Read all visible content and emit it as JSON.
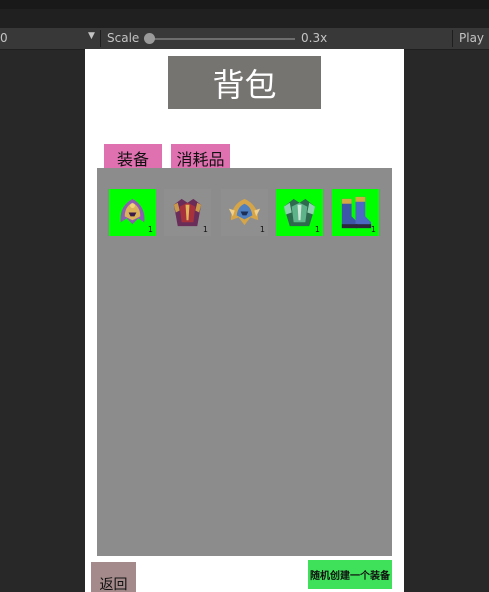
{
  "toolbar": {
    "resolution": "0",
    "scale_label": "Scale",
    "scale_value": "0.3x",
    "scale_level": 0.0,
    "play_label": "Play I"
  },
  "panel": {
    "title": "背包",
    "tabs": [
      {
        "label": "装备"
      },
      {
        "label": "消耗品"
      }
    ],
    "items": [
      {
        "icon": "helmet-purple-icon",
        "count": "1",
        "background": "#00ff00"
      },
      {
        "icon": "chest-armor-red-icon",
        "count": "1",
        "background": "#8f8f8f"
      },
      {
        "icon": "helmet-blue-icon",
        "count": "1",
        "background": "#8f8f8f"
      },
      {
        "icon": "chest-armor-green-icon",
        "count": "1",
        "background": "#00ff00"
      },
      {
        "icon": "boots-blue-icon",
        "count": "1",
        "background": "#00ff00"
      }
    ],
    "back_button": "返回",
    "random_button": "随机创建一个装备"
  },
  "colors": {
    "tab": "#e071b0",
    "title_bg": "#767471",
    "grid_bg": "#8c8c8c",
    "random_button": "#3fe05a",
    "back_button": "#a48a8a"
  }
}
